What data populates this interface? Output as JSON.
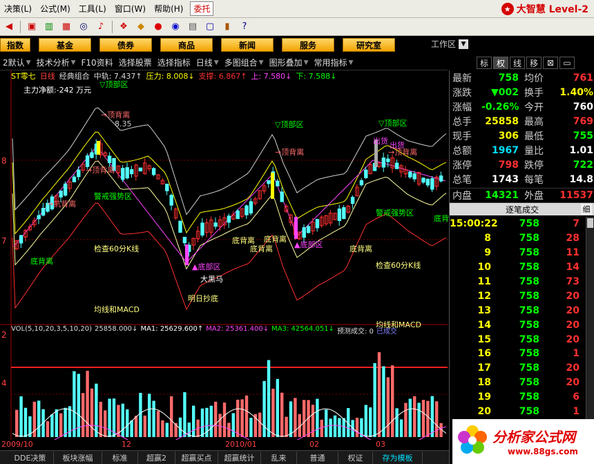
{
  "menu": [
    "决策(L)",
    "公式(M)",
    "工具(L)",
    "窗口(W)",
    "帮助(H)"
  ],
  "entrust": "委托",
  "brand": "大智慧 Level-2",
  "toolbar_icons": [
    "back-icon",
    "tile-icon",
    "chart-icon",
    "bar-icon",
    "binoculars-icon",
    "alarm-icon",
    "invest-icon",
    "diamond-icon",
    "dragon-icon",
    "globe-icon",
    "notebook-icon",
    "window-icon",
    "books-icon",
    "help-icon"
  ],
  "nav": [
    "指数",
    "基金",
    "债券",
    "商品",
    "新闻",
    "服务",
    "研究室"
  ],
  "workspace": "工作区",
  "funcbar": [
    {
      "label": "2默认",
      "arrow": true
    },
    {
      "label": "技术分析",
      "arrow": true
    },
    {
      "label": "F10资料",
      "arrow": false
    },
    {
      "label": "选择股票",
      "arrow": false
    },
    {
      "label": "选择指标",
      "arrow": false
    },
    {
      "label": "日线",
      "arrow": true
    },
    {
      "label": "多图组合",
      "arrow": true
    },
    {
      "label": "图形叠加",
      "arrow": true
    },
    {
      "label": "常用指标",
      "arrow": true
    }
  ],
  "right_tabs": [
    "标",
    "权",
    "线",
    "移",
    "⊠",
    "▭"
  ],
  "info": {
    "stock": "ST零七",
    "period": "日线",
    "combo": "经典组合",
    "mid": "中轨: 7.437↑",
    "pressure": "压力: 8.008↓",
    "support": "支撑: 6.867↑",
    "up": "上: 7.580↓",
    "down": "下: 7.588↓"
  },
  "main_fund": "主力净额:-242 万元",
  "price_axis": [
    "8",
    "7",
    "7"
  ],
  "annotations": [
    {
      "text": "▽顶部区",
      "color": "#00ff00"
    },
    {
      "text": "→顶背离",
      "color": "#ff6a6a"
    },
    {
      "text": "8.35",
      "color": "#cccccc"
    },
    {
      "text": "→顶背离",
      "color": "#ff6a6a"
    },
    {
      "text": "→顶背离",
      "color": "#ff6a6a"
    },
    {
      "text": "▽顶部区",
      "color": "#00ff00"
    },
    {
      "text": "→顶背离",
      "color": "#ff6a6a"
    },
    {
      "text": "▽顶部区",
      "color": "#00ff00"
    },
    {
      "text": "→抗背离",
      "color": "#ff6a6a"
    },
    {
      "text": "警戒强势区",
      "color": "#00ff00"
    },
    {
      "text": "警戒强势区",
      "color": "#00ff00"
    },
    {
      "text": "出货",
      "color": "#ff44ff"
    },
    {
      "text": "出货",
      "color": "#ff44ff"
    },
    {
      "text": "底背离",
      "color": "#00ff00"
    },
    {
      "text": "检查60分K线",
      "color": "#ffff80"
    },
    {
      "text": "底背离",
      "color": "#ffff80"
    },
    {
      "text": "底背离",
      "color": "#ffff80"
    },
    {
      "text": "底背离",
      "color": "#ffff80"
    },
    {
      "text": "▲底部区",
      "color": "#ff44ff"
    },
    {
      "text": "底背离",
      "color": "#ffff80"
    },
    {
      "text": "▲底部区",
      "color": "#ff44ff"
    },
    {
      "text": "大黑马",
      "color": "#ffffff"
    },
    {
      "text": "检查60分K线",
      "color": "#ffff80"
    },
    {
      "text": "明日抄底",
      "color": "#ffff80"
    },
    {
      "text": "均线和MACD",
      "color": "#ffff80"
    },
    {
      "text": "均线和MACD",
      "color": "#ffff80"
    },
    {
      "text": "底背离",
      "color": "#00ff00"
    }
  ],
  "vol": {
    "label": "VOL(5,10,20,3,5,10,20)",
    "value": "25858.000↓",
    "ma1": "MA1: 25629.600↑",
    "ma2": "MA2: 25361.400↓",
    "ma3": "MA3: 42564.051↓",
    "forecast": "预测成交: 0",
    "done": "已成交"
  },
  "vol_axis": [
    "2",
    "4"
  ],
  "dates": [
    "2009/10",
    "12",
    "2010/01",
    "02",
    "03"
  ],
  "bottom_tabs": [
    "DDE决策",
    "板块涨幅",
    "标准",
    "超赢2",
    "超赢买点",
    "超赢统计",
    "乱来",
    "普通",
    "权证",
    "存为模板"
  ],
  "quote": {
    "rows": [
      {
        "l1": "最新",
        "v1": "758",
        "c1": "#00ff00",
        "l2": "均价",
        "v2": "761",
        "c2": "#ff3030"
      },
      {
        "l1": "涨跌",
        "v1": "▼002",
        "c1": "#00ff00",
        "l2": "换手",
        "v2": "1.40%",
        "c2": "#ffff00"
      },
      {
        "l1": "涨幅",
        "v1": "-0.26%",
        "c1": "#00ff00",
        "l2": "今开",
        "v2": "760",
        "c2": "#ffffff"
      },
      {
        "l1": "总手",
        "v1": "25858",
        "c1": "#ffff00",
        "l2": "最高",
        "v2": "769",
        "c2": "#ff3030"
      },
      {
        "l1": "现手",
        "v1": "306",
        "c1": "#ffff00",
        "l2": "最低",
        "v2": "755",
        "c2": "#00ff00"
      },
      {
        "l1": "总额",
        "v1": "1967",
        "c1": "#00e0ff",
        "l2": "量比",
        "v2": "1.01",
        "c2": "#ffffff"
      },
      {
        "l1": "涨停",
        "v1": "798",
        "c1": "#ff3030",
        "l2": "跌停",
        "v2": "722",
        "c2": "#00ff00"
      },
      {
        "l1": "总笔",
        "v1": "1743",
        "c1": "#ffffff",
        "l2": "每笔",
        "v2": "14.8",
        "c2": "#ffffff"
      }
    ],
    "inner_label": "内盘",
    "inner": "14321",
    "outer_label": "外盘",
    "outer": "11537"
  },
  "tick_title": "逐笔成交",
  "tick_detail": "细",
  "ticks": [
    {
      "t": "15:00:22",
      "p": "758",
      "v": "7"
    },
    {
      "t": "8",
      "p": "758",
      "v": "28"
    },
    {
      "t": "9",
      "p": "758",
      "v": "11"
    },
    {
      "t": "10",
      "p": "758",
      "v": "14"
    },
    {
      "t": "11",
      "p": "758",
      "v": "73"
    },
    {
      "t": "12",
      "p": "758",
      "v": "20"
    },
    {
      "t": "13",
      "p": "758",
      "v": "20"
    },
    {
      "t": "14",
      "p": "758",
      "v": "20"
    },
    {
      "t": "15",
      "p": "758",
      "v": "20"
    },
    {
      "t": "16",
      "p": "758",
      "v": "1"
    },
    {
      "t": "17",
      "p": "758",
      "v": "20"
    },
    {
      "t": "18",
      "p": "758",
      "v": "20"
    },
    {
      "t": "19",
      "p": "758",
      "v": "6"
    },
    {
      "t": "20",
      "p": "758",
      "v": "1"
    }
  ],
  "watermark": {
    "title": "分析家公式网",
    "url": "www.88gs.com"
  }
}
